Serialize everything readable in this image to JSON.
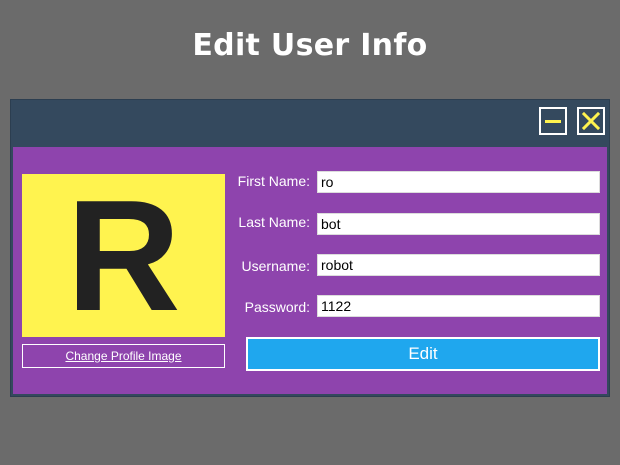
{
  "slide": {
    "title": "Edit User Info"
  },
  "window": {
    "minimize_label": "Minimize",
    "close_label": "Close",
    "accent_color": "#fff34f"
  },
  "profile": {
    "avatar_letter": "R",
    "avatar_bg": "#fff34f",
    "change_image_label": "Change Profile Image"
  },
  "form": {
    "first_name": {
      "label": "First Name:",
      "value": "ro"
    },
    "last_name": {
      "label": "Last Name:",
      "value": "bot"
    },
    "username": {
      "label": "Username:",
      "value": "robot"
    },
    "password": {
      "label": "Password:",
      "value": "1122"
    },
    "edit_label": "Edit"
  },
  "colors": {
    "background": "#6b6b6b",
    "titlebar": "#34495e",
    "content": "#8e44ad",
    "button": "#1fa7ee"
  }
}
